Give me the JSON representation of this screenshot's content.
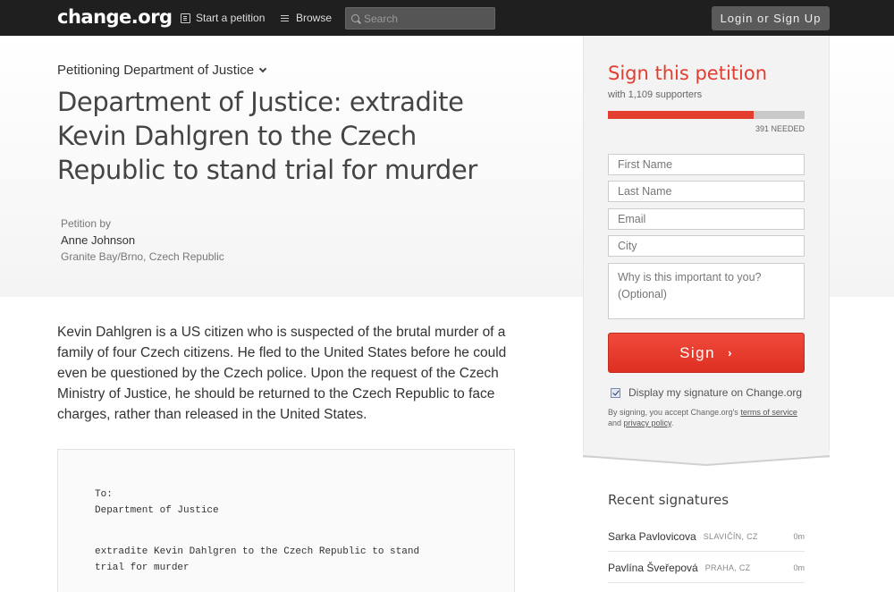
{
  "nav": {
    "logo": "change.org",
    "start_petition": "Start a petition",
    "browse": "Browse",
    "search_placeholder": "Search",
    "login": "Login or Sign Up"
  },
  "petition": {
    "petitioning": "Petitioning Department of Justice",
    "title": "Department of Justice: extradite Kevin Dahlgren to the Czech Republic to stand trial for murder",
    "petition_by_label": "Petition by",
    "author": "Anne Johnson",
    "location": "Granite Bay/Brno, Czech Republic",
    "description": "Kevin Dahlgren is a US citizen who is suspected of the brutal murder of a family of four Czech citizens. He fled to the United States before he could even be questioned by the Czech police. Upon the request of the Czech Ministry of Justice, he should be returned to the Czech Republic to face charges, rather than released in the United States."
  },
  "letter": {
    "to_label": "To:",
    "recipient": "Department of Justice",
    "line1": "extradite Kevin Dahlgren to the Czech Republic to stand",
    "line2": "trial for murder"
  },
  "sign_panel": {
    "title": "Sign this petition",
    "supporters": "with 1,109 supporters",
    "progress_fraction": 0.74,
    "needed": "391 NEEDED",
    "first_name_placeholder": "First Name",
    "last_name_placeholder": "Last Name",
    "email_placeholder": "Email",
    "city_placeholder": "City",
    "why_placeholder": "Why is this important to you? (Optional)",
    "sign_button": "Sign",
    "display_signature": "Display my signature on Change.org",
    "display_checked": true,
    "terms_prefix": "By signing, you accept Change.org's ",
    "terms_link": "terms of service",
    "terms_and": " and ",
    "privacy_link": "privacy policy",
    "terms_suffix": "."
  },
  "recent": {
    "title": "Recent signatures",
    "items": [
      {
        "name": "Sarka Pavlovicova",
        "location": "SLAVIČÍN, CZ",
        "time": "0m"
      },
      {
        "name": "Pavlína Šveřepová",
        "location": "PRAHA, CZ",
        "time": "0m"
      }
    ]
  },
  "colors": {
    "accent": "#e23d2f",
    "topbar": "#1f1f1f"
  }
}
